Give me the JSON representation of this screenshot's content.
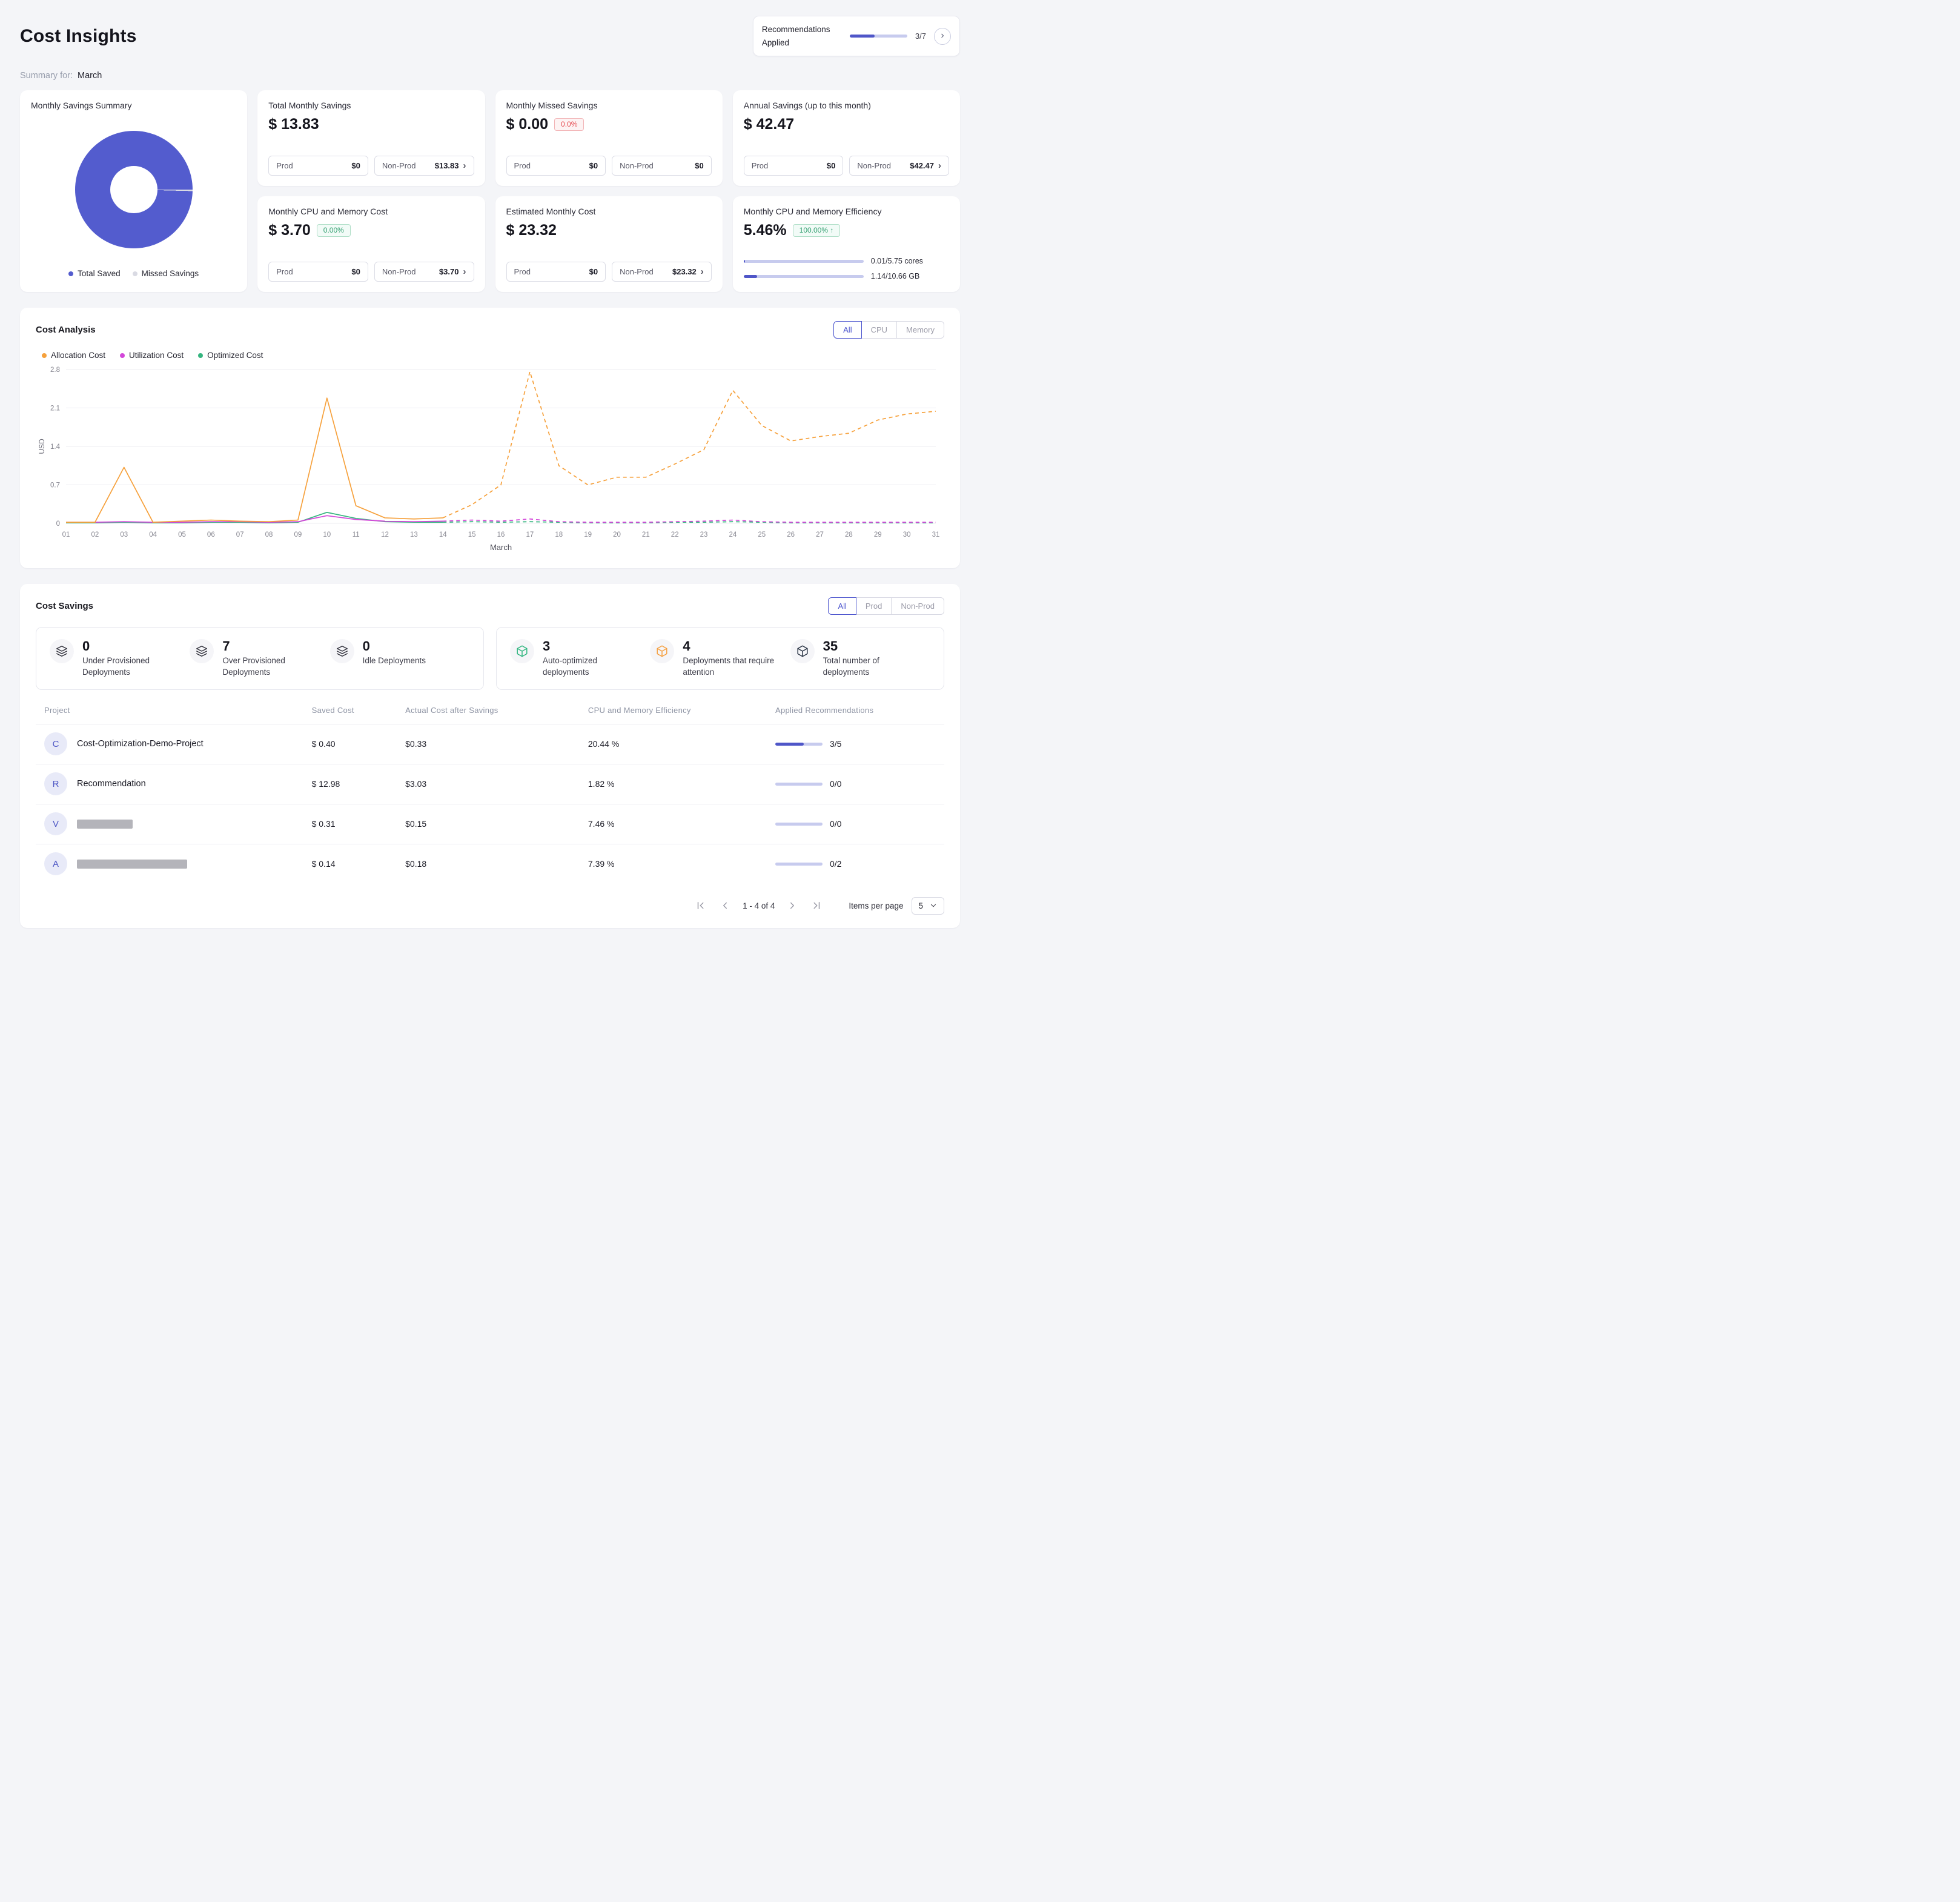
{
  "page": {
    "title": "Cost Insights",
    "summary_label": "Summary for:",
    "summary_value": "March"
  },
  "recommendations": {
    "label": "Recommendations Applied",
    "progress_text": "3/7",
    "progress_pct": 43
  },
  "summary_cards": {
    "savings_summary": {
      "title": "Monthly Savings Summary",
      "saved_pct": 99.6,
      "legend": [
        {
          "label": "Total Saved",
          "color": "#535cce"
        },
        {
          "label": "Missed Savings",
          "color": "#d9dae3"
        }
      ]
    },
    "total_savings": {
      "title": "Total Monthly Savings",
      "value": "$ 13.83",
      "prod_label": "Prod",
      "prod_value": "$0",
      "nonprod_label": "Non-Prod",
      "nonprod_value": "$13.83"
    },
    "missed_savings": {
      "title": "Monthly Missed Savings",
      "value": "$ 0.00",
      "badge": "0.0%",
      "prod_label": "Prod",
      "prod_value": "$0",
      "nonprod_label": "Non-Prod",
      "nonprod_value": "$0"
    },
    "annual_savings": {
      "title": "Annual Savings (up to this month)",
      "value": "$ 42.47",
      "prod_label": "Prod",
      "prod_value": "$0",
      "nonprod_label": "Non-Prod",
      "nonprod_value": "$42.47"
    },
    "cpu_memory_cost": {
      "title": "Monthly CPU and Memory Cost",
      "value": "$ 3.70",
      "badge": "0.00%",
      "prod_label": "Prod",
      "prod_value": "$0",
      "nonprod_label": "Non-Prod",
      "nonprod_value": "$3.70"
    },
    "estimated_cost": {
      "title": "Estimated Monthly Cost",
      "value": "$ 23.32",
      "prod_label": "Prod",
      "prod_value": "$0",
      "nonprod_label": "Non-Prod",
      "nonprod_value": "$23.32"
    },
    "efficiency": {
      "title": "Monthly CPU and Memory Efficiency",
      "value": "5.46%",
      "badge": "100.00% ↑",
      "cores_label": "0.01/5.75 cores",
      "cores_pct": 1,
      "memory_label": "1.14/10.66 GB",
      "memory_pct": 11
    }
  },
  "cost_analysis": {
    "title": "Cost Analysis",
    "tabs": [
      {
        "label": "All",
        "active": true
      },
      {
        "label": "CPU",
        "active": false
      },
      {
        "label": "Memory",
        "active": false
      }
    ]
  },
  "chart_data": {
    "type": "line",
    "title": "Cost Analysis",
    "xlabel": "March",
    "ylabel": "USD",
    "x": [
      "01",
      "02",
      "03",
      "04",
      "05",
      "06",
      "07",
      "08",
      "09",
      "10",
      "11",
      "12",
      "13",
      "14",
      "15",
      "16",
      "17",
      "18",
      "19",
      "20",
      "21",
      "22",
      "23",
      "24",
      "25",
      "26",
      "27",
      "28",
      "29",
      "30",
      "31"
    ],
    "yticks": [
      "0",
      "0.7",
      "1.4",
      "2.1",
      "2.8"
    ],
    "ylim": [
      0,
      2.8
    ],
    "grid": true,
    "legend_position": "top-left",
    "forecast_start_index": 13,
    "series": [
      {
        "name": "Allocation Cost",
        "color": "#f6a13c",
        "values": [
          0.02,
          0.02,
          1.02,
          0.02,
          0.04,
          0.06,
          0.04,
          0.03,
          0.06,
          2.28,
          0.32,
          0.1,
          0.08,
          0.1,
          0.34,
          0.7,
          2.76,
          1.05,
          0.7,
          0.84,
          0.84,
          1.08,
          1.34,
          2.42,
          1.78,
          1.5,
          1.58,
          1.64,
          1.88,
          1.99,
          2.04
        ]
      },
      {
        "name": "Utilization Cost",
        "color": "#d347d9",
        "values": [
          0.02,
          0.02,
          0.03,
          0.02,
          0.02,
          0.03,
          0.03,
          0.02,
          0.03,
          0.14,
          0.07,
          0.04,
          0.03,
          0.04,
          0.06,
          0.04,
          0.08,
          0.03,
          0.02,
          0.02,
          0.02,
          0.03,
          0.04,
          0.06,
          0.03,
          0.02,
          0.02,
          0.02,
          0.02,
          0.02,
          0.02
        ]
      },
      {
        "name": "Optimized Cost",
        "color": "#35b57f",
        "values": [
          0.01,
          0.01,
          0.02,
          0.01,
          0.01,
          0.02,
          0.02,
          0.01,
          0.02,
          0.2,
          0.09,
          0.03,
          0.02,
          0.02,
          0.03,
          0.02,
          0.03,
          0.02,
          0.01,
          0.01,
          0.01,
          0.02,
          0.02,
          0.03,
          0.02,
          0.01,
          0.01,
          0.01,
          0.01,
          0.01,
          0.01
        ]
      }
    ]
  },
  "cost_savings": {
    "title": "Cost Savings",
    "tabs": [
      {
        "label": "All",
        "active": true
      },
      {
        "label": "Prod",
        "active": false
      },
      {
        "label": "Non-Prod",
        "active": false
      }
    ],
    "provisioning_stats": [
      {
        "value": "0",
        "label": "Under Provisioned Deployments"
      },
      {
        "value": "7",
        "label": "Over Provisioned Deployments"
      },
      {
        "value": "0",
        "label": "Idle Deployments"
      }
    ],
    "deployment_stats": [
      {
        "value": "3",
        "label": "Auto-optimized deployments",
        "color": "#2eb57e"
      },
      {
        "value": "4",
        "label": "Deployments that require attention",
        "color": "#f59e3d"
      },
      {
        "value": "35",
        "label": "Total number of deployments",
        "color": "#273142"
      }
    ],
    "table": {
      "columns": [
        "Project",
        "Saved Cost",
        "Actual Cost after Savings",
        "CPU and Memory Efficiency",
        "Applied Recommendations"
      ],
      "rows": [
        {
          "initial": "C",
          "name": "Cost-Optimization-Demo-Project",
          "saved": "$ 0.40",
          "actual": "$0.33",
          "efficiency": "20.44 %",
          "recs": "3/5",
          "recs_pct": 60
        },
        {
          "initial": "R",
          "name": "Recommendation",
          "saved": "$ 12.98",
          "actual": "$3.03",
          "efficiency": "1.82 %",
          "recs": "0/0",
          "recs_pct": 0
        },
        {
          "initial": "V",
          "name": "",
          "saved": "$ 0.31",
          "actual": "$0.15",
          "efficiency": "7.46 %",
          "recs": "0/0",
          "recs_pct": 0
        },
        {
          "initial": "A",
          "name": "",
          "saved": "$ 0.14",
          "actual": "$0.18",
          "efficiency": "7.39 %",
          "recs": "0/2",
          "recs_pct": 0
        }
      ]
    },
    "pagination": {
      "range": "1 - 4 of 4",
      "items_per_page_label": "Items per page",
      "items_per_page": "5"
    }
  }
}
